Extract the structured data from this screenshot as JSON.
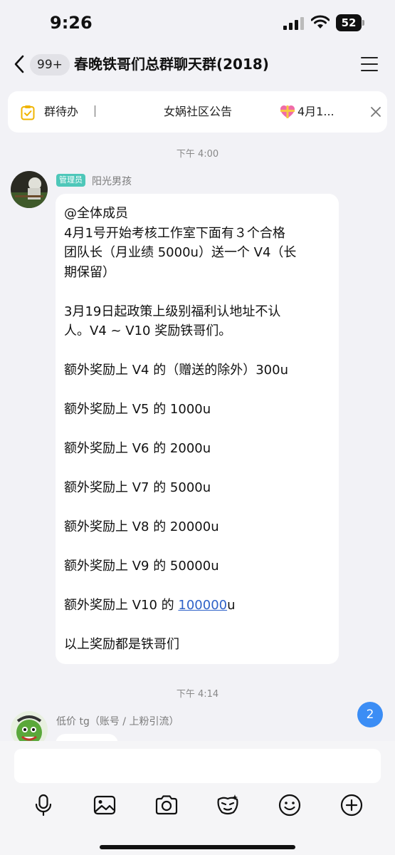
{
  "status_bar": {
    "time": "9:26",
    "battery": "52"
  },
  "nav": {
    "unread_count": "99+",
    "title": "春晚铁哥们总群聊天群(2018)"
  },
  "pinned": {
    "todo_label": "群待办",
    "notice_label": "女娲社区公告",
    "notice2_label": "4月1..."
  },
  "messages": [
    {
      "timestamp": "下午 4:00",
      "badge": "管理员",
      "sender": "阳光男孩",
      "lines": [
        "@全体成员",
        "4月1号开始考核工作室下面有３个合格",
        "团队长（月业绩 5000u）送一个 V4（长",
        "期保留）",
        "",
        "3月19日起政策上级别福利认地址不认",
        "人。V4 ~ V10 奖励铁哥们。",
        "",
        "额外奖励上 V4 的（赠送的除外）300u",
        "",
        "额外奖励上 V5 的 1000u",
        "",
        "额外奖励上 V6 的 2000u",
        "",
        "额外奖励上 V7 的 5000u",
        "",
        "额外奖励上 V8 的 20000u",
        "",
        "额外奖励上 V9 的 50000u",
        ""
      ],
      "v10_prefix": "额外奖励上 V10 的 ",
      "v10_link": "100000",
      "v10_suffix": "u",
      "closing": "以上奖励都是铁哥们"
    },
    {
      "timestamp": "下午 4:14",
      "sender": "低价 tg（账号 / 上粉引流）"
    }
  ],
  "unread_pill": "2",
  "toolbar": [
    "microphone-icon",
    "image-icon",
    "camera-icon",
    "sticker-icon",
    "emoji-icon",
    "add-icon"
  ]
}
